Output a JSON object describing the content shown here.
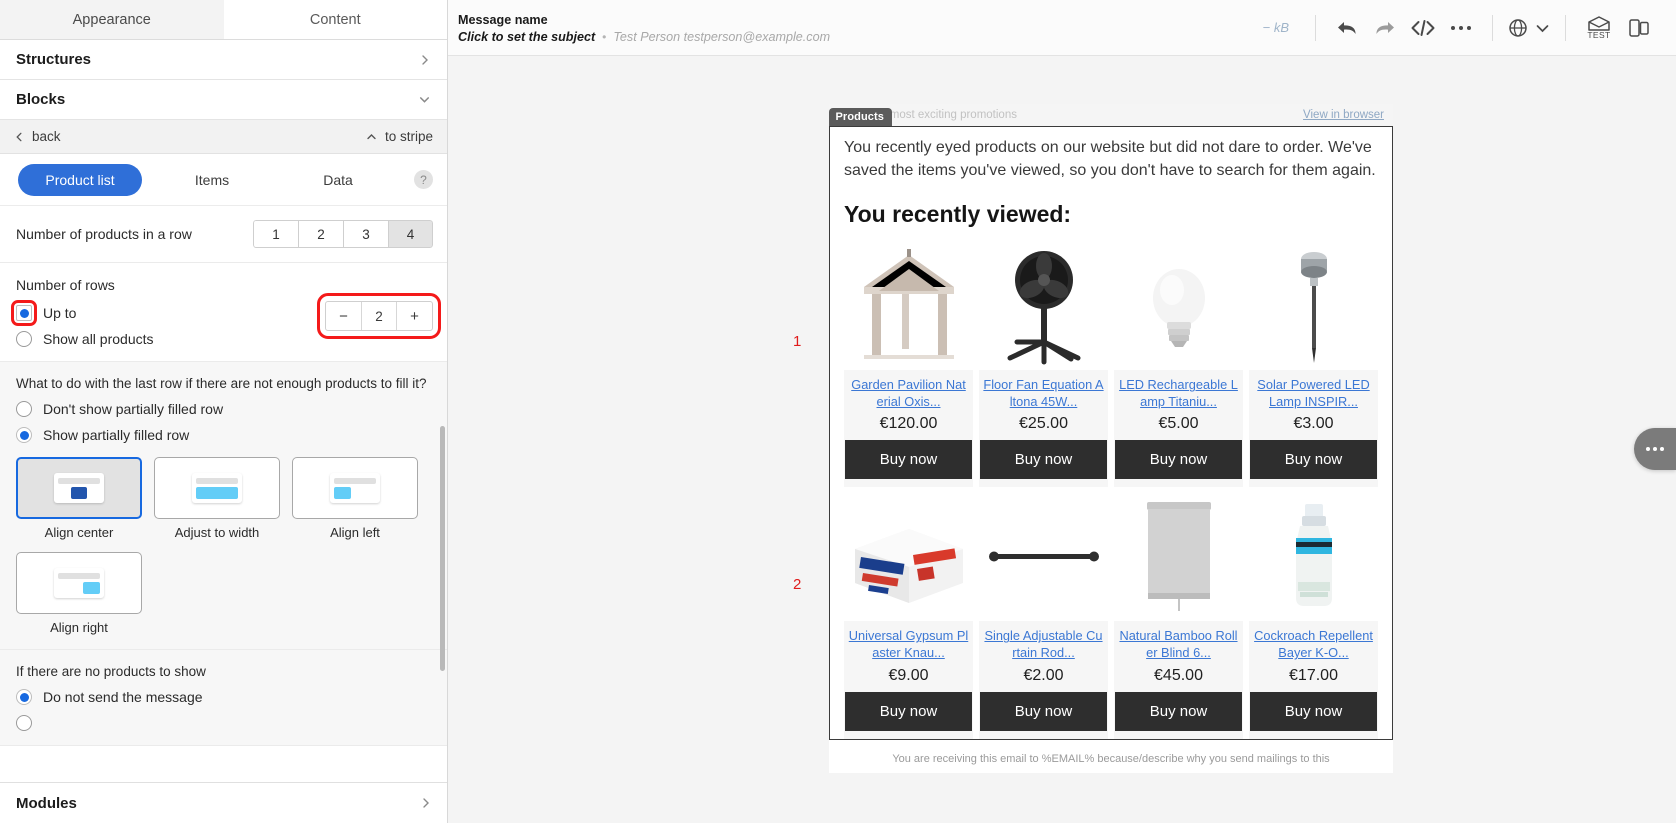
{
  "left_panel": {
    "tabs": [
      {
        "label": "Appearance",
        "active": true
      },
      {
        "label": "Content",
        "active": false
      }
    ],
    "sections": [
      {
        "label": "Structures",
        "icon": "chevron-right-icon"
      },
      {
        "label": "Blocks",
        "icon": "chevron-down-icon"
      },
      {
        "label": "Modules",
        "icon": "chevron-right-icon"
      }
    ],
    "back_bar": {
      "back_label": "back",
      "to_stripe_label": "to stripe"
    },
    "sub_tabs": [
      {
        "label": "Product list",
        "active": true
      },
      {
        "label": "Items",
        "active": false
      },
      {
        "label": "Data",
        "active": false
      }
    ],
    "help_label": "?",
    "products_in_row": {
      "label": "Number of products in a row",
      "options": [
        "1",
        "2",
        "3",
        "4"
      ],
      "selected": "4"
    },
    "number_of_rows": {
      "label": "Number of rows",
      "options": [
        {
          "label": "Up to",
          "selected": true,
          "highlighted": true
        },
        {
          "label": "Show all products",
          "selected": false,
          "highlighted": false
        }
      ],
      "stepper": {
        "minus_label": "−",
        "value": "2",
        "plus_label": "+",
        "highlighted": true
      }
    },
    "last_row": {
      "question": "What to do with the last row if there are not enough products to fill it?",
      "options": [
        {
          "label": "Don't show partially filled row",
          "selected": false
        },
        {
          "label": "Show partially filled row",
          "selected": true
        }
      ],
      "alignments": [
        {
          "label": "Align center",
          "selected": true,
          "pos": "center",
          "width": "small"
        },
        {
          "label": "Adjust to width",
          "selected": false,
          "pos": "center",
          "width": "full"
        },
        {
          "label": "Align left",
          "selected": false,
          "pos": "left",
          "width": "small"
        },
        {
          "label": "Align right",
          "selected": false,
          "pos": "right",
          "width": "small"
        }
      ]
    },
    "no_products": {
      "label": "If there are no products to show",
      "options": [
        {
          "label": "Do not send the message",
          "selected": true
        }
      ]
    }
  },
  "topbar": {
    "message_name": "Message name",
    "subject_placeholder": "Click to set the subject",
    "separator": "•",
    "sender": "Test Person testperson@example.com",
    "size": "− kB",
    "icons": [
      {
        "name": "undo-icon",
        "label": "undo"
      },
      {
        "name": "redo-icon",
        "label": "redo"
      },
      {
        "name": "code-icon",
        "label": "</>"
      },
      {
        "name": "more-icon",
        "label": "…"
      },
      {
        "name": "language-globe-icon",
        "label": "language"
      },
      {
        "name": "chevron-down-icon",
        "label": "expand"
      },
      {
        "name": "test-email-icon",
        "label": "TEST"
      },
      {
        "name": "device-preview-icon",
        "label": "preview"
      }
    ],
    "test_badge": "TEST"
  },
  "preview": {
    "block_tag": "Products",
    "preheader": "der of the most exciting promotions",
    "view_in_browser": "View in browser",
    "intro": "You recently eyed products on our website but did not dare to order. We've saved the items you've viewed, so you don't have to search for them again.",
    "headline": "You recently viewed:",
    "buy_label": "Buy now",
    "row_markers": [
      "1",
      "2"
    ],
    "footer_note": "You are receiving this email to %EMAIL% because/describe why you send mailings to this",
    "products": [
      {
        "name": "Garden Pavilion Nat erial Oxis...",
        "price": "€120.00",
        "image": "garden-pavilion-image"
      },
      {
        "name": "Floor Fan Equation A ltona 45W...",
        "price": "€25.00",
        "image": "floor-fan-image"
      },
      {
        "name": "LED Rechargeable L amp Titaniu...",
        "price": "€5.00",
        "image": "led-bulb-image"
      },
      {
        "name": "Solar Powered LED Lamp INSPIR...",
        "price": "€3.00",
        "image": "solar-lamp-image"
      },
      {
        "name": "Universal Gypsum Pl aster Knau...",
        "price": "€9.00",
        "image": "gypsum-plaster-image"
      },
      {
        "name": "Single Adjustable Cu rtain Rod...",
        "price": "€2.00",
        "image": "curtain-rod-image"
      },
      {
        "name": "Natural Bamboo Roll er Blind 6...",
        "price": "€45.00",
        "image": "roller-blind-image"
      },
      {
        "name": "Cockroach Repellent Bayer K-O...",
        "price": "€17.00",
        "image": "repellent-image"
      }
    ],
    "float_menu_icon": "more-options-icon"
  },
  "colors": {
    "accent": "#2f6fd8",
    "radio_on": "#1769e0",
    "highlight": "#f41a1a",
    "link": "#3b77d4",
    "button": "#2e2e2e",
    "tag": "#5b5b5b"
  }
}
